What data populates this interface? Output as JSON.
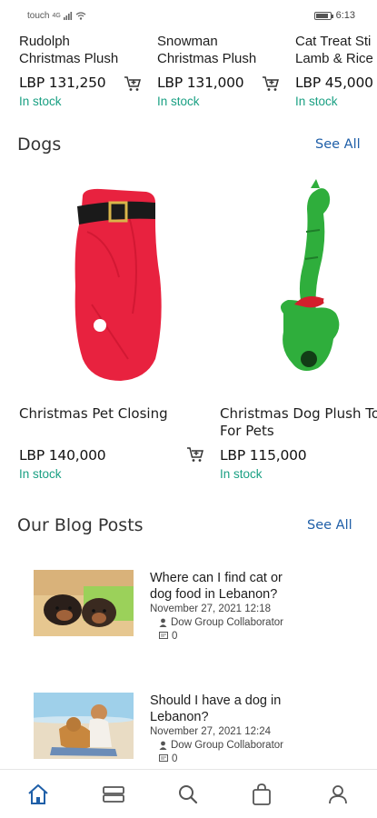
{
  "status_bar": {
    "carrier": "touch",
    "network": "4G",
    "time": "6:13",
    "battery_level": 0.85
  },
  "top_products": [
    {
      "name_line1": "Rudolph",
      "name_line2": "Christmas Plush",
      "price": "LBP 131,250",
      "stock": "In stock"
    },
    {
      "name_line1": "Snowman",
      "name_line2": "Christmas Plush",
      "price": "LBP 131,000",
      "stock": "In stock"
    },
    {
      "name_line1": "Cat Treat Sti",
      "name_line2": "Lamb & Rice",
      "price": "LBP 45,000",
      "stock": "In stock"
    }
  ],
  "dogs_section": {
    "title": "Dogs",
    "see_all": "See All",
    "products": [
      {
        "name_line1": "Christmas Pet Closing",
        "name_line2": "",
        "price": "LBP 140,000",
        "stock": "In stock"
      },
      {
        "name_line1": "Christmas Dog Plush To",
        "name_line2": "For Pets",
        "price": "LBP 115,000",
        "stock": "In stock"
      }
    ]
  },
  "blog_section": {
    "title": "Our Blog Posts",
    "see_all": "See All",
    "posts": [
      {
        "title_line1": "Where can I find cat or",
        "title_line2": "dog food in Lebanon?",
        "date": "November 27, 2021 12:18",
        "author": "Dow Group Collaborator",
        "comments": "0"
      },
      {
        "title_line1": "Should I have a dog in",
        "title_line2": "Lebanon?",
        "date": "November 27, 2021 12:24",
        "author": "Dow Group Collaborator",
        "comments": "0"
      }
    ]
  },
  "bottom_nav": [
    {
      "icon": "home-icon",
      "active": true
    },
    {
      "icon": "categories-icon",
      "active": false
    },
    {
      "icon": "search-icon",
      "active": false
    },
    {
      "icon": "shopping-bag-icon",
      "active": false
    },
    {
      "icon": "user-icon",
      "active": false
    }
  ],
  "colors": {
    "in_stock": "#1aa083",
    "link": "#1f5fa8",
    "nav_active": "#1f5fa8",
    "nav_inactive": "#555555"
  }
}
